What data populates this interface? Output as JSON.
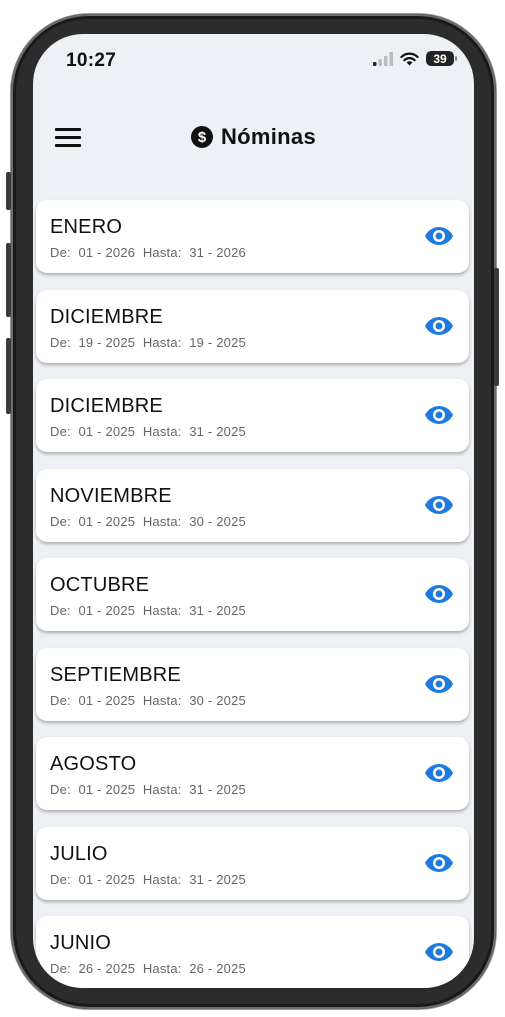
{
  "status_bar": {
    "time": "10:27",
    "battery": "39"
  },
  "header": {
    "title": "Nóminas"
  },
  "payrolls": [
    {
      "month": "ENERO",
      "from_label": "De:",
      "from": "01 - 2026",
      "to_label": "Hasta:",
      "to": "31 - 2026"
    },
    {
      "month": "DICIEMBRE",
      "from_label": "De:",
      "from": "19 - 2025",
      "to_label": "Hasta:",
      "to": "19 - 2025"
    },
    {
      "month": "DICIEMBRE",
      "from_label": "De:",
      "from": "01 - 2025",
      "to_label": "Hasta:",
      "to": "31 - 2025"
    },
    {
      "month": "NOVIEMBRE",
      "from_label": "De:",
      "from": "01 - 2025",
      "to_label": "Hasta:",
      "to": "30 - 2025"
    },
    {
      "month": "OCTUBRE",
      "from_label": "De:",
      "from": "01 - 2025",
      "to_label": "Hasta:",
      "to": "31 - 2025"
    },
    {
      "month": "SEPTIEMBRE",
      "from_label": "De:",
      "from": "01 - 2025",
      "to_label": "Hasta:",
      "to": "30 - 2025"
    },
    {
      "month": "AGOSTO",
      "from_label": "De:",
      "from": "01 - 2025",
      "to_label": "Hasta:",
      "to": "31 - 2025"
    },
    {
      "month": "JULIO",
      "from_label": "De:",
      "from": "01 - 2025",
      "to_label": "Hasta:",
      "to": "31 - 2025"
    },
    {
      "month": "JUNIO",
      "from_label": "De:",
      "from": "26 - 2025",
      "to_label": "Hasta:",
      "to": "26 - 2025"
    }
  ],
  "colors": {
    "accent": "#1f7ae0",
    "background": "#edf0f4",
    "card": "#ffffff"
  },
  "icons": {
    "menu": "hamburger-menu-icon",
    "title": "dollar-circle-icon",
    "view": "eye-icon"
  }
}
